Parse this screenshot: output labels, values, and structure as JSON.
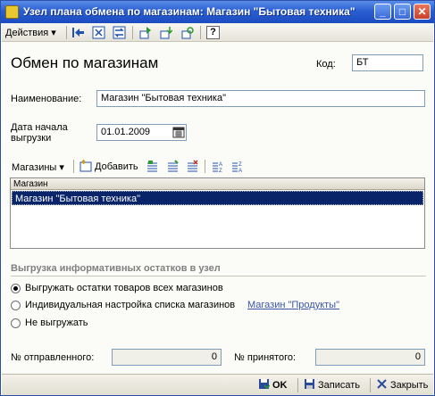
{
  "window": {
    "title": "Узел плана обмена по магазинам: Магазин \"Бытовая техника\"",
    "minimize": "_",
    "maximize": "□",
    "close": "✕"
  },
  "toolbar": {
    "actions_label": "Действия ▾",
    "icons": [
      "back-arrow-icon",
      "formula-icon",
      "swap-icon",
      "upload-icon",
      "download-icon",
      "refresh-icon",
      "help-icon"
    ],
    "help": "?"
  },
  "form": {
    "heading": "Обмен по магазинам",
    "code_label": "Код:",
    "code_value": "БТ",
    "name_label": "Наименование:",
    "name_value": "Магазин \"Бытовая техника\"",
    "date_label_line1": "Дата начала",
    "date_label_line2": "выгрузки",
    "date_value": "01.01.2009"
  },
  "stores": {
    "menu_label": "Магазины ▾",
    "add_label": "Добавить",
    "column_header": "Магазин",
    "rows": [
      "Магазин \"Бытовая техника\""
    ]
  },
  "export_section": {
    "title": "Выгрузка информативных остатков в узел",
    "options": [
      {
        "label": "Выгружать остатки товаров всех магазинов",
        "selected": true
      },
      {
        "label": "Индивидуальная настройка списка магазинов",
        "selected": false
      },
      {
        "label": "Не выгружать",
        "selected": false
      }
    ],
    "link_text": "Магазин \"Продукты\""
  },
  "counters": {
    "sent_label": "№ отправленного:",
    "sent_value": "0",
    "received_label": "№ принятого:",
    "received_value": "0"
  },
  "footer": {
    "ok_label": "OK",
    "save_label": "Записать",
    "close_label": "Закрыть"
  },
  "colors": {
    "title_bar": "#2a5fd0",
    "selection": "#0a246a",
    "link": "#3a55a8"
  }
}
